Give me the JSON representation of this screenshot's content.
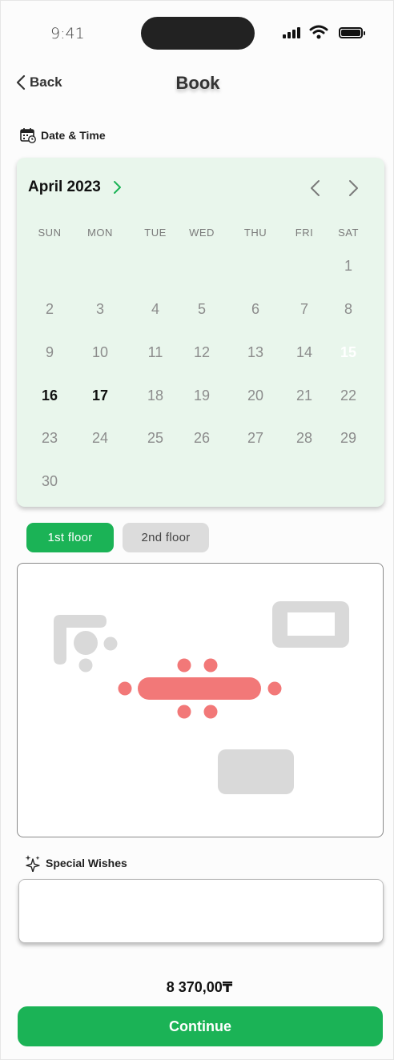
{
  "status_bar": {
    "time": "9:41"
  },
  "header": {
    "back_label": "Back",
    "title": "Book"
  },
  "date_section": {
    "label": "Date & Time"
  },
  "calendar": {
    "month_label": "April 2023",
    "weekdays": [
      "SUN",
      "MON",
      "TUE",
      "WED",
      "THU",
      "FRI",
      "SAT"
    ],
    "days": [
      {
        "d": "1",
        "col": 6,
        "row": 0
      },
      {
        "d": "2",
        "col": 0,
        "row": 1
      },
      {
        "d": "3",
        "col": 1,
        "row": 1
      },
      {
        "d": "4",
        "col": 2,
        "row": 1
      },
      {
        "d": "5",
        "col": 3,
        "row": 1
      },
      {
        "d": "6",
        "col": 4,
        "row": 1
      },
      {
        "d": "7",
        "col": 5,
        "row": 1
      },
      {
        "d": "8",
        "col": 6,
        "row": 1
      },
      {
        "d": "9",
        "col": 0,
        "row": 2
      },
      {
        "d": "10",
        "col": 1,
        "row": 2
      },
      {
        "d": "11",
        "col": 2,
        "row": 2
      },
      {
        "d": "12",
        "col": 3,
        "row": 2
      },
      {
        "d": "13",
        "col": 4,
        "row": 2
      },
      {
        "d": "14",
        "col": 5,
        "row": 2
      },
      {
        "d": "15",
        "col": 6,
        "row": 2,
        "state": "selected"
      },
      {
        "d": "16",
        "col": 0,
        "row": 3,
        "state": "available"
      },
      {
        "d": "17",
        "col": 1,
        "row": 3,
        "state": "available"
      },
      {
        "d": "18",
        "col": 2,
        "row": 3
      },
      {
        "d": "19",
        "col": 3,
        "row": 3
      },
      {
        "d": "20",
        "col": 4,
        "row": 3
      },
      {
        "d": "21",
        "col": 5,
        "row": 3
      },
      {
        "d": "22",
        "col": 6,
        "row": 3
      },
      {
        "d": "23",
        "col": 0,
        "row": 4
      },
      {
        "d": "24",
        "col": 1,
        "row": 4
      },
      {
        "d": "25",
        "col": 2,
        "row": 4
      },
      {
        "d": "26",
        "col": 3,
        "row": 4
      },
      {
        "d": "27",
        "col": 4,
        "row": 4
      },
      {
        "d": "28",
        "col": 5,
        "row": 4
      },
      {
        "d": "29",
        "col": 6,
        "row": 4
      },
      {
        "d": "30",
        "col": 0,
        "row": 5
      }
    ],
    "accent_color": "#1bb356",
    "background_color": "#e9f6ec"
  },
  "floors": {
    "first_label": "1st  floor",
    "second_label": "2nd  floor",
    "selected": "1st  floor"
  },
  "floor_plan": {
    "selected_table_color": "#f27878",
    "unavailable_color": "#d9d9d9"
  },
  "wishes": {
    "label": "Special Wishes",
    "value": ""
  },
  "price": "8 370,00₸",
  "continue_label": "Continue",
  "icons": {
    "back": "chevron-left-icon",
    "calendar": "calendar-clock-icon",
    "month_forward": "chevron-right-icon",
    "prev_month": "chevron-left-icon",
    "next_month": "chevron-right-icon",
    "wishes": "sparkles-icon"
  }
}
